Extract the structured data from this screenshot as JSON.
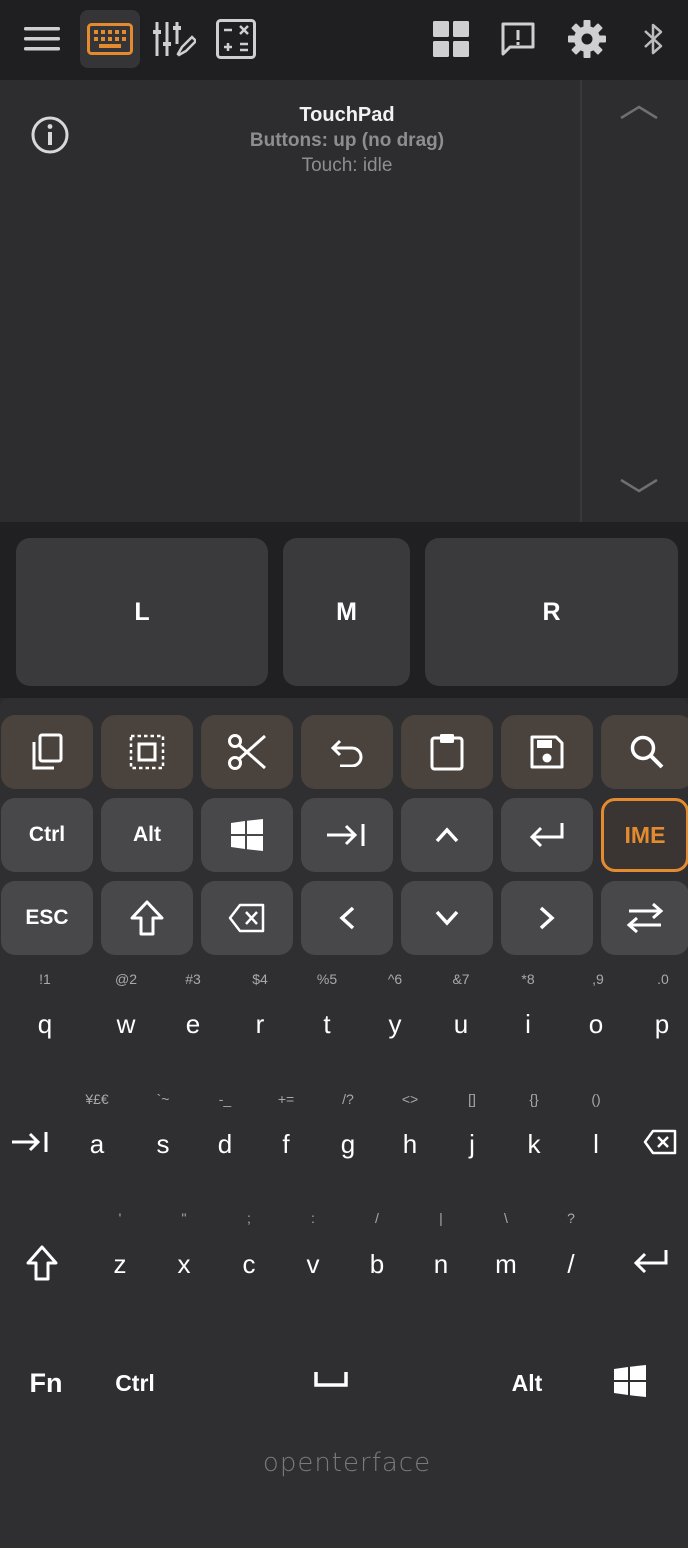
{
  "touchpad": {
    "title": "TouchPad",
    "buttons_status": "Buttons: up (no drag)",
    "touch_status": "Touch: idle"
  },
  "mouse_buttons": {
    "left": "L",
    "middle": "M",
    "right": "R"
  },
  "special_keys": {
    "ctrl": "Ctrl",
    "alt": "Alt",
    "ime": "IME",
    "esc": "ESC"
  },
  "row1": {
    "hints": [
      "!1",
      "@2",
      "#3",
      "$4",
      "%5",
      "^6",
      "&7",
      "*8",
      ",9",
      ".0"
    ],
    "letters": [
      "q",
      "w",
      "e",
      "r",
      "t",
      "y",
      "u",
      "i",
      "o",
      "p"
    ]
  },
  "row2": {
    "hints": [
      "¥£€",
      "`~",
      "-_",
      "+=",
      "/?",
      "<>",
      "[]",
      "{}",
      "()"
    ],
    "letters": [
      "a",
      "s",
      "d",
      "f",
      "g",
      "h",
      "j",
      "k",
      "l"
    ]
  },
  "row3": {
    "hints": [
      "'",
      "\"",
      ";",
      ":",
      "/",
      "|",
      "\\",
      "?"
    ],
    "letters": [
      "z",
      "x",
      "c",
      "v",
      "b",
      "n",
      "m",
      "/"
    ]
  },
  "bottom_row": {
    "fn": "Fn",
    "ctrl": "Ctrl",
    "alt": "Alt"
  },
  "brand": "openterface",
  "colors": {
    "accent": "#e48a2f",
    "toolbar_bg": "#1f1f21",
    "touchpad_bg": "#2d2d30",
    "keyboard_bg": "#2f2f31",
    "shortcut_key_bg": "#4a423c",
    "modifier_key_bg": "#48484b"
  },
  "icons": {
    "toolbar": [
      "menu-icon",
      "keyboard-icon",
      "sliders-edit-icon",
      "calculator-icon",
      "dashboard-icon",
      "feedback-icon",
      "settings-gear-icon",
      "bluetooth-icon"
    ],
    "shortcuts": [
      "copy-icon",
      "select-all-icon",
      "cut-icon",
      "undo-icon",
      "paste-icon",
      "save-icon",
      "search-icon"
    ]
  }
}
